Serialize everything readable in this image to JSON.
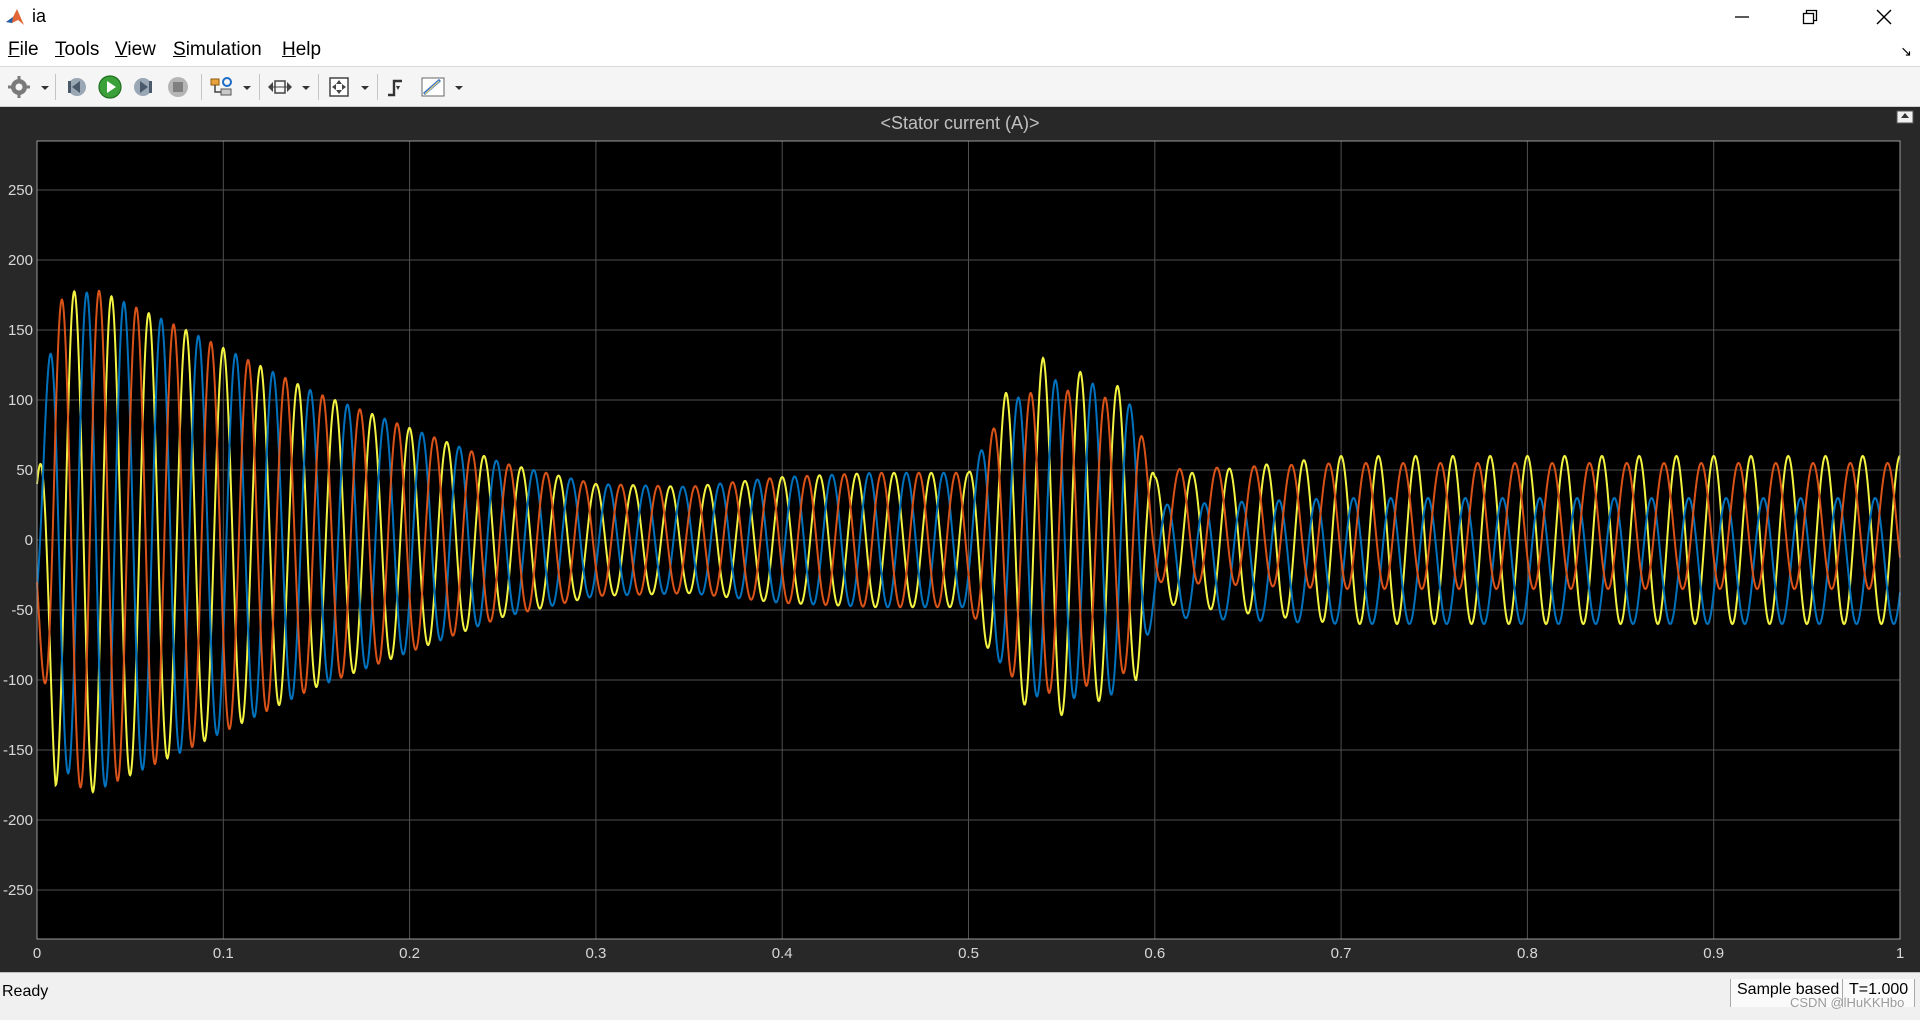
{
  "window": {
    "title": "ia"
  },
  "menu": [
    "File",
    "Tools",
    "View",
    "Simulation",
    "Help"
  ],
  "menu_mnemonic": [
    "F",
    "T",
    "V",
    "S",
    "H"
  ],
  "toolbar_icons": [
    "settings-icon",
    "step-back-icon",
    "run-icon",
    "step-forward-icon",
    "stop-icon",
    "highlight-block-icon",
    "zoom-icon",
    "fit-axes-icon",
    "trigger-icon",
    "measurements-icon"
  ],
  "colors": {
    "background": "#000000",
    "grid": "#505050",
    "frame": "#282828",
    "tick_text": "#d8d8d8",
    "series": [
      "#f3f342",
      "#0072bd",
      "#d95319"
    ]
  },
  "chart_data": {
    "type": "line",
    "title": "<Stator current (A)>",
    "xlabel": "",
    "ylabel": "",
    "xlim": [
      0,
      1
    ],
    "ylim": [
      -285,
      285
    ],
    "xticks": [
      0,
      0.1,
      0.2,
      0.3,
      0.4,
      0.5,
      0.6,
      0.7,
      0.8,
      0.9,
      1
    ],
    "xtick_labels": [
      "0",
      "0.1",
      "0.2",
      "0.3",
      "0.4",
      "0.5",
      "0.6",
      "0.7",
      "0.8",
      "0.9",
      "1"
    ],
    "yticks": [
      -250,
      -200,
      -150,
      -100,
      -50,
      0,
      50,
      100,
      150,
      200,
      250
    ],
    "ytick_labels": [
      "-250",
      "-200",
      "-150",
      "-100",
      "-50",
      "0",
      "50",
      "100",
      "150",
      "200",
      "250"
    ],
    "grid": true,
    "frequency_hz": 50,
    "series": [
      {
        "color": "#f3f342",
        "phase_deg": 90,
        "envelope": [
          [
            0,
            40
          ],
          [
            0.01,
            175
          ],
          [
            0.03,
            180
          ],
          [
            0.08,
            150
          ],
          [
            0.15,
            105
          ],
          [
            0.2,
            80
          ],
          [
            0.25,
            55
          ],
          [
            0.3,
            40
          ],
          [
            0.35,
            38
          ],
          [
            0.4,
            45
          ],
          [
            0.45,
            48
          ],
          [
            0.5,
            48
          ],
          [
            0.52,
            105
          ],
          [
            0.54,
            130
          ],
          [
            0.58,
            110
          ],
          [
            0.59,
            100
          ],
          [
            0.6,
            45
          ],
          [
            0.7,
            60
          ],
          [
            1.0,
            60
          ]
        ],
        "offset": [
          [
            0,
            0
          ],
          [
            0.59,
            0
          ],
          [
            0.6,
            0
          ],
          [
            1.0,
            0
          ]
        ]
      },
      {
        "color": "#0072bd",
        "phase_deg": -30,
        "envelope": [
          [
            0,
            70
          ],
          [
            0.01,
            160
          ],
          [
            0.03,
            180
          ],
          [
            0.08,
            150
          ],
          [
            0.15,
            105
          ],
          [
            0.2,
            80
          ],
          [
            0.25,
            55
          ],
          [
            0.3,
            40
          ],
          [
            0.35,
            38
          ],
          [
            0.4,
            45
          ],
          [
            0.45,
            48
          ],
          [
            0.5,
            48
          ],
          [
            0.52,
            95
          ],
          [
            0.54,
            115
          ],
          [
            0.58,
            110
          ],
          [
            0.59,
            90
          ],
          [
            0.6,
            40
          ],
          [
            0.7,
            45
          ],
          [
            1.0,
            45
          ]
        ],
        "offset": [
          [
            0,
            0
          ],
          [
            0.59,
            0
          ],
          [
            0.6,
            -15
          ],
          [
            1.0,
            -15
          ]
        ]
      },
      {
        "color": "#d95319",
        "phase_deg": 210,
        "envelope": [
          [
            0,
            60
          ],
          [
            0.01,
            170
          ],
          [
            0.03,
            180
          ],
          [
            0.08,
            150
          ],
          [
            0.15,
            105
          ],
          [
            0.2,
            80
          ],
          [
            0.25,
            55
          ],
          [
            0.3,
            40
          ],
          [
            0.35,
            38
          ],
          [
            0.4,
            45
          ],
          [
            0.45,
            48
          ],
          [
            0.5,
            48
          ],
          [
            0.52,
            95
          ],
          [
            0.54,
            110
          ],
          [
            0.58,
            100
          ],
          [
            0.59,
            85
          ],
          [
            0.6,
            40
          ],
          [
            0.7,
            45
          ],
          [
            1.0,
            45
          ]
        ],
        "offset": [
          [
            0,
            0
          ],
          [
            0.59,
            0
          ],
          [
            0.6,
            10
          ],
          [
            1.0,
            10
          ]
        ]
      }
    ]
  },
  "status": {
    "text": "Ready",
    "sample_mode": "Sample based",
    "time": "T=1.000"
  },
  "watermark": "CSDN @lHuKKHbo"
}
